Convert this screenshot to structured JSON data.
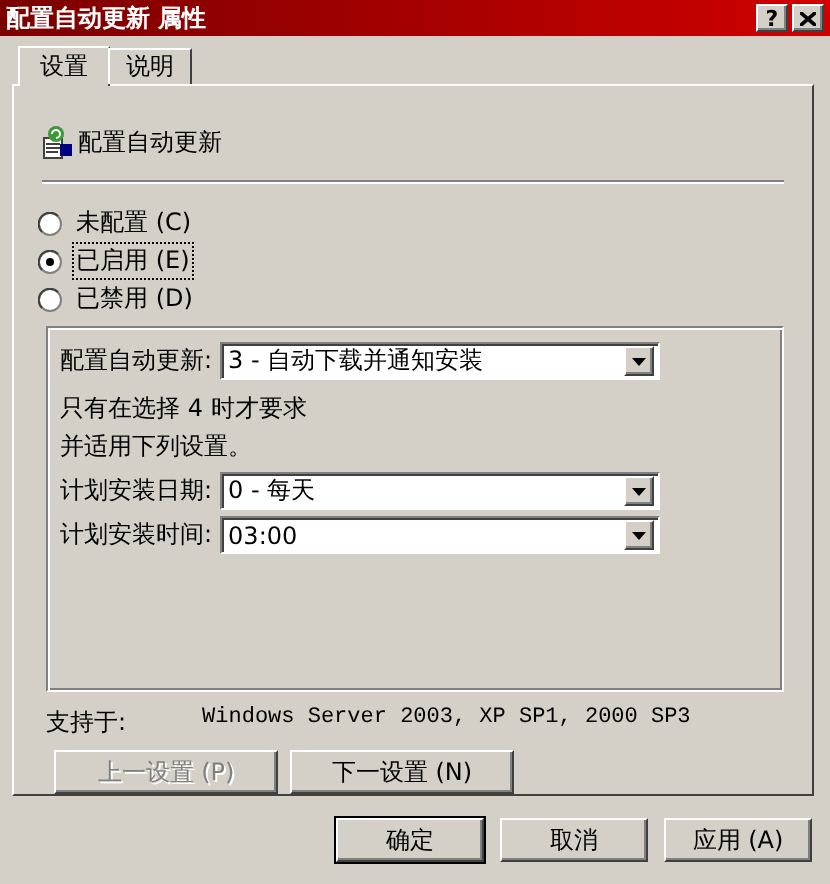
{
  "window": {
    "title": "配置自动更新 属性",
    "help_button": "?"
  },
  "tabs": [
    {
      "label": "设置",
      "selected": true
    },
    {
      "label": "说明",
      "selected": false
    }
  ],
  "policy": {
    "title": "配置自动更新"
  },
  "options": [
    {
      "label": "未配置 (C)",
      "selected": false,
      "focused": false
    },
    {
      "label": "已启用 (E)",
      "selected": true,
      "focused": true
    },
    {
      "label": "已禁用 (D)",
      "selected": false,
      "focused": false
    }
  ],
  "settings": {
    "fields": [
      {
        "label": "配置自动更新:",
        "value": "3 - 自动下载并通知安装"
      }
    ],
    "note_lines": [
      "只有在选择 4 时才要求",
      "并适用下列设置。"
    ],
    "schedule": [
      {
        "label": "计划安装日期:",
        "value": "0 - 每天"
      },
      {
        "label": "计划安装时间:",
        "value": "03:00"
      }
    ]
  },
  "supported": {
    "label": "支持于:",
    "value": "Windows Server 2003, XP SP1, 2000 SP3"
  },
  "nav_buttons": [
    {
      "label": "上一设置 (P)",
      "disabled": true
    },
    {
      "label": "下一设置 (N)",
      "disabled": false
    }
  ],
  "buttons": [
    {
      "label": "确定",
      "default": true
    },
    {
      "label": "取消",
      "default": false
    },
    {
      "label": "应用 (A)",
      "default": false
    }
  ]
}
